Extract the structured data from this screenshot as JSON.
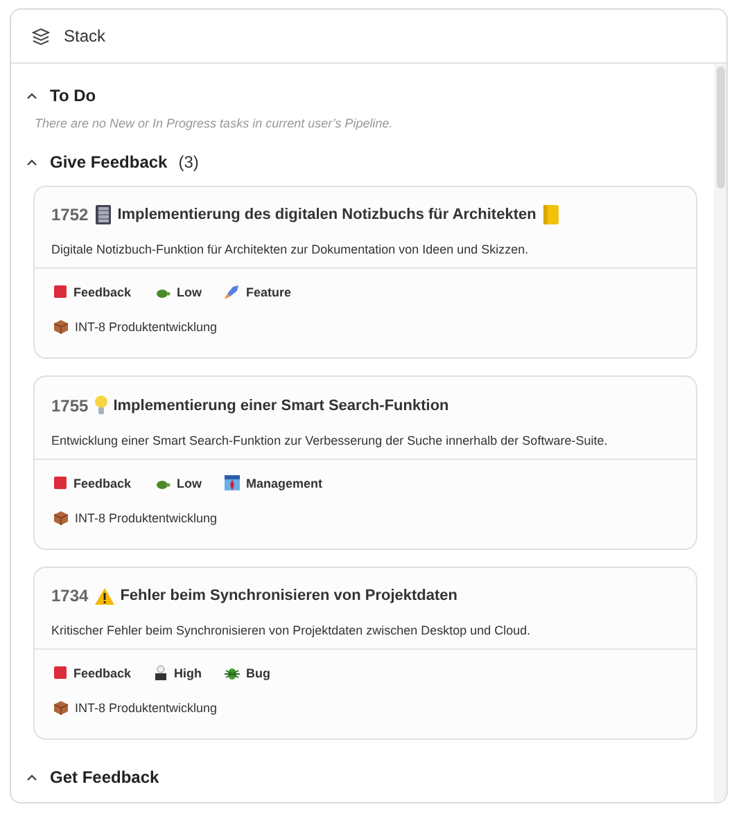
{
  "panel": {
    "title": "Stack"
  },
  "sections": [
    {
      "title": "To Do",
      "expanded": true,
      "empty_message": "There are no New or In Progress tasks in current user’s Pipeline."
    },
    {
      "title": "Give Feedback",
      "expanded": true,
      "count": "(3)",
      "tasks": [
        {
          "id": "1752",
          "kind": "notebook",
          "title": "Implementierung des digitalen Notizbuchs für Architekten",
          "description": "Digitale Notizbuch-Funktion für Architekten zur Dokumentation von Ideen und Skizzen.",
          "tags": [
            {
              "kind": "status",
              "label": "Feedback"
            },
            {
              "kind": "low",
              "label": "Low"
            },
            {
              "kind": "feature",
              "label": "Feature"
            }
          ],
          "project": "INT-8 Produktentwicklung"
        },
        {
          "id": "1755",
          "kind": "idea",
          "title": "Implementierung einer Smart Search-Funktion",
          "description": "Entwicklung einer Smart Search-Funktion zur Verbesserung der Suche innerhalb der Software-Suite.",
          "tags": [
            {
              "kind": "status",
              "label": "Feedback"
            },
            {
              "kind": "low",
              "label": "Low"
            },
            {
              "kind": "management",
              "label": "Management"
            }
          ],
          "project": "INT-8 Produktentwicklung"
        },
        {
          "id": "1734",
          "kind": "warning",
          "title": "Fehler beim Synchronisieren von Projektdaten",
          "description": "Kritischer Fehler beim Synchronisieren von Projektdaten zwischen Desktop und Cloud.",
          "tags": [
            {
              "kind": "status",
              "label": "Feedback"
            },
            {
              "kind": "high",
              "label": "High"
            },
            {
              "kind": "bug",
              "label": "Bug"
            }
          ],
          "project": "INT-8 Produktentwicklung"
        }
      ]
    },
    {
      "title": "Get Feedback",
      "expanded": true
    }
  ]
}
